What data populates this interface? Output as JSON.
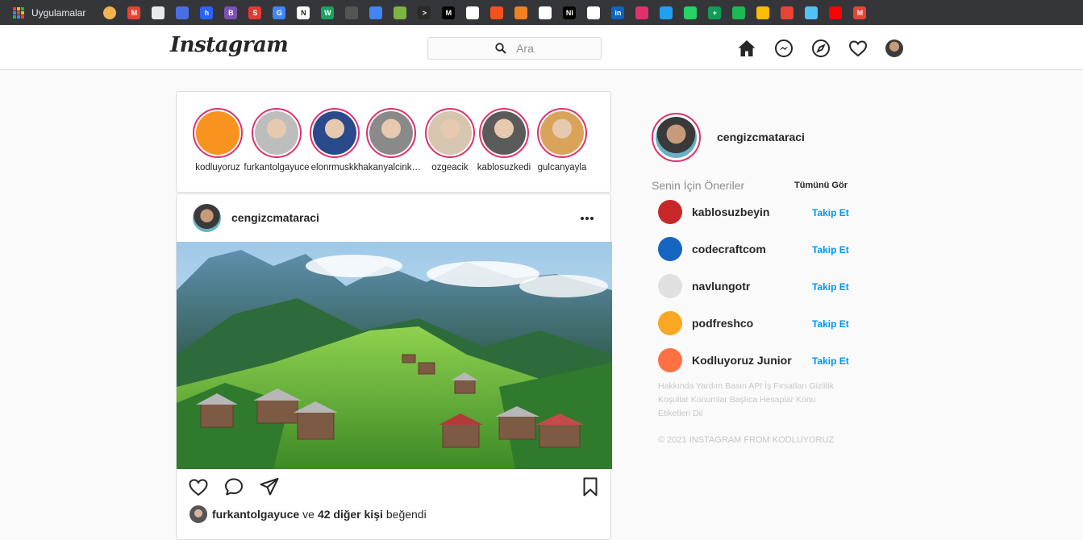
{
  "bookmarks": {
    "apps_label": "Uygulamalar",
    "items": [
      {
        "icon": "circle-icon",
        "color": "#f4b350",
        "glyph": ""
      },
      {
        "icon": "gmail-icon",
        "color": "#ea4335",
        "glyph": "M"
      },
      {
        "icon": "github-icon",
        "color": "#e8eaed",
        "glyph": ""
      },
      {
        "icon": "flag-icon",
        "color": "#4a6fe3",
        "glyph": ""
      },
      {
        "icon": "hashnode-icon",
        "color": "#2962ff",
        "glyph": "h"
      },
      {
        "icon": "bootstrap-icon",
        "color": "#7952b3",
        "glyph": "B"
      },
      {
        "icon": "s-icon",
        "color": "#e53935",
        "glyph": "S"
      },
      {
        "icon": "translate-icon",
        "color": "#4285f4",
        "glyph": "G"
      },
      {
        "icon": "notion-icon",
        "color": "#ffffff",
        "glyph": "N"
      },
      {
        "icon": "w-icon",
        "color": "#1aa260",
        "glyph": "W"
      },
      {
        "icon": "screen-icon",
        "color": "#555555",
        "glyph": ""
      },
      {
        "icon": "cube-icon",
        "color": "#4285f4",
        "glyph": ""
      },
      {
        "icon": "leaf-icon",
        "color": "#7cb342",
        "glyph": ""
      },
      {
        "icon": "terminal-icon",
        "color": "#2b2b2b",
        "glyph": ">"
      },
      {
        "icon": "m-icon",
        "color": "#000000",
        "glyph": "M"
      },
      {
        "icon": "codepen-icon",
        "color": "#ffffff",
        "glyph": ""
      },
      {
        "icon": "brand-red-icon",
        "color": "#f4511e",
        "glyph": ""
      },
      {
        "icon": "stack-icon",
        "color": "#f48024",
        "glyph": ""
      },
      {
        "icon": "devto-icon",
        "color": "#ffffff",
        "glyph": ""
      },
      {
        "icon": "ni-icon",
        "color": "#000000",
        "glyph": "NI"
      },
      {
        "icon": "bank-icon",
        "color": "#ffffff",
        "glyph": ""
      },
      {
        "icon": "linkedin-icon",
        "color": "#0a66c2",
        "glyph": "in"
      },
      {
        "icon": "instagram-icon",
        "color": "#e1306c",
        "glyph": ""
      },
      {
        "icon": "twitter-icon",
        "color": "#1da1f2",
        "glyph": ""
      },
      {
        "icon": "whatsapp-icon",
        "color": "#25d366",
        "glyph": ""
      },
      {
        "icon": "sheets-icon",
        "color": "#0f9d58",
        "glyph": "+"
      },
      {
        "icon": "spotify-icon",
        "color": "#1db954",
        "glyph": ""
      },
      {
        "icon": "drive-icon",
        "color": "#fbbc04",
        "glyph": ""
      },
      {
        "icon": "photos-icon",
        "color": "#ea4335",
        "glyph": ""
      },
      {
        "icon": "drop-icon",
        "color": "#4fc3f7",
        "glyph": ""
      },
      {
        "icon": "youtube-icon",
        "color": "#ff0000",
        "glyph": ""
      },
      {
        "icon": "gmail-icon",
        "color": "#ea4335",
        "glyph": "M"
      }
    ]
  },
  "header": {
    "logo": "Instagram",
    "search_placeholder": "Ara"
  },
  "stories": [
    {
      "name": "kodluyoruz",
      "color": "#f7931e"
    },
    {
      "name": "furkantolgayuce",
      "color": "#bdbdbd"
    },
    {
      "name": "elonrmuskk",
      "color": "#2b4a8b"
    },
    {
      "name": "hakanyalcinkaya",
      "color": "#8a8a8a"
    },
    {
      "name": "ozgeacik",
      "color": "#d6c6b0"
    },
    {
      "name": "kablosuzkedi",
      "color": "#5a5a5a"
    },
    {
      "name": "gulcanyayla",
      "color": "#d9a45a"
    }
  ],
  "post": {
    "username": "cengizcmataraci",
    "liked_by": "furkantolgayuce",
    "liked_and": "ve",
    "others": "42 diğer kişi",
    "liked_suffix": "beğendi"
  },
  "sidebar": {
    "username": "cengizcmataraci",
    "suggest_title": "Senin İçin Öneriler",
    "see_all": "Tümünü Gör",
    "suggestions": [
      {
        "name": "kablosuzbeyin",
        "follow": "Takip Et",
        "color": "#c62828"
      },
      {
        "name": "codecraftcom",
        "follow": "Takip Et",
        "color": "#1565c0"
      },
      {
        "name": "navlungotr",
        "follow": "Takip Et",
        "color": "#e0e0e0"
      },
      {
        "name": "podfreshco",
        "follow": "Takip Et",
        "color": "#f9a825"
      },
      {
        "name": "Kodluyoruz Junior",
        "follow": "Takip Et",
        "color": "#ff7043"
      }
    ],
    "footer_links": "Hakkında Yardım Basın API İş Fırsatları Gizlilik Koşullar Konumlar Başlıca Hesaplar Konu Etiketleri Dil",
    "copyright": "© 2021 INSTAGRAM FROM KODLUYORUZ"
  }
}
